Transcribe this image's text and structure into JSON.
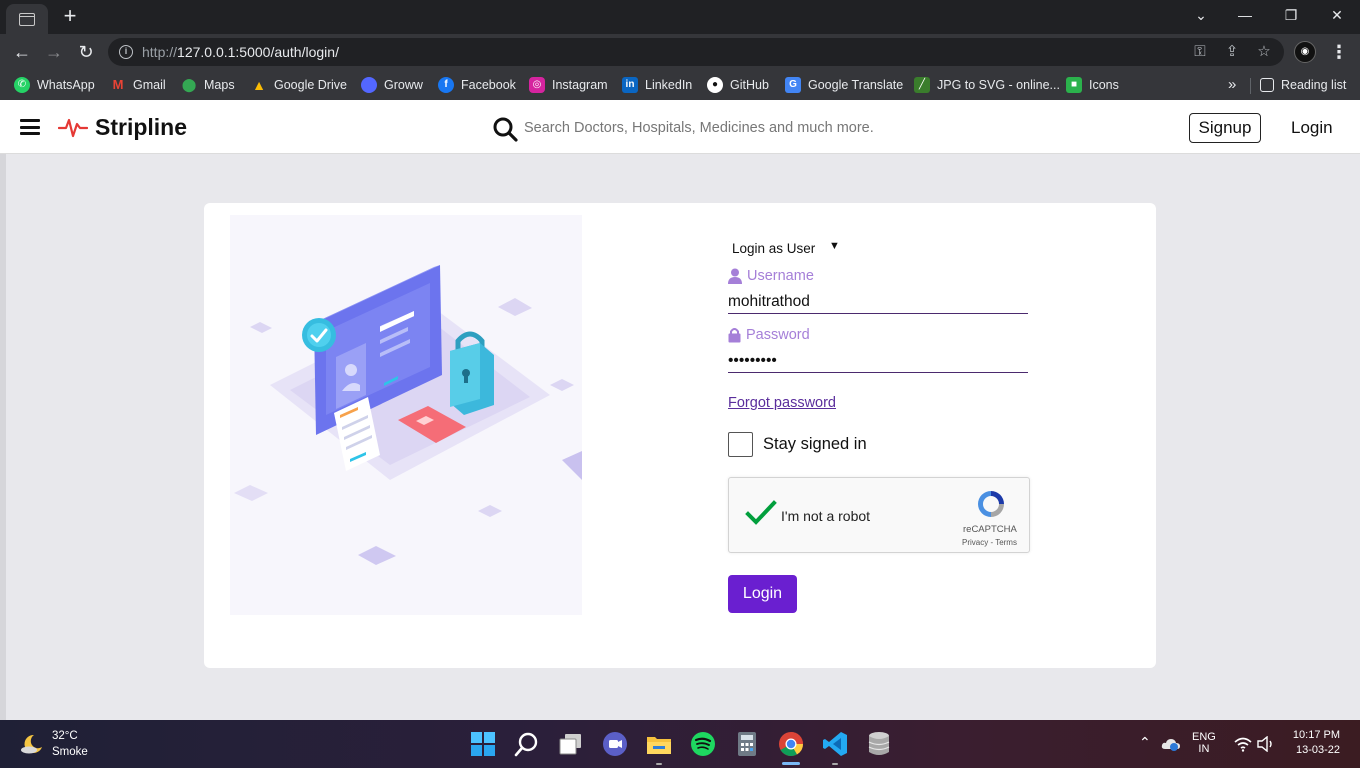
{
  "browser": {
    "url_scheme_prefix": "http://",
    "url_host": "127.0.0.1",
    "url_path": ":5000/auth/login/",
    "new_tab_symbol": "+",
    "bookmarks": [
      {
        "label": "WhatsApp",
        "color": "#25d366"
      },
      {
        "label": "Gmail",
        "color": "#ea4335"
      },
      {
        "label": "Maps",
        "color": "#34a853"
      },
      {
        "label": "Google Drive",
        "color": "#fbbc04"
      },
      {
        "label": "Groww",
        "color": "#00d09c"
      },
      {
        "label": "Facebook",
        "color": "#1877f2"
      },
      {
        "label": "Instagram",
        "color": "#d6249f"
      },
      {
        "label": "LinkedIn",
        "color": "#0a66c2"
      },
      {
        "label": "GitHub",
        "color": "#ffffff"
      },
      {
        "label": "Google Translate",
        "color": "#4285f4"
      },
      {
        "label": "JPG to SVG - online...",
        "color": "#3a7d2c"
      },
      {
        "label": "Icons",
        "color": "#2bb24c"
      }
    ],
    "more_bookmarks": "»",
    "reading_list": "Reading list"
  },
  "site": {
    "brand": "Stripline",
    "search_placeholder": "Search Doctors, Hospitals, Medicines and much more.",
    "signup_label": "Signup",
    "login_link": "Login",
    "accent_color": "#6a1fd0"
  },
  "form": {
    "role_selected": "Login as User",
    "username_label": "Username",
    "username_value": "mohitrathod",
    "password_label": "Password",
    "password_value": "•••••••••",
    "forgot_label": "Forgot password",
    "stay_signed_in": "Stay signed in",
    "recaptcha_label": "I'm not a robot",
    "recaptcha_brand": "reCAPTCHA",
    "recaptcha_links": "Privacy - Terms",
    "login_button": "Login"
  },
  "taskbar": {
    "temperature": "32°C",
    "weather": "Smoke",
    "lang_line1": "ENG",
    "lang_line2": "IN",
    "time": "10:17 PM",
    "date": "13-03-22"
  }
}
